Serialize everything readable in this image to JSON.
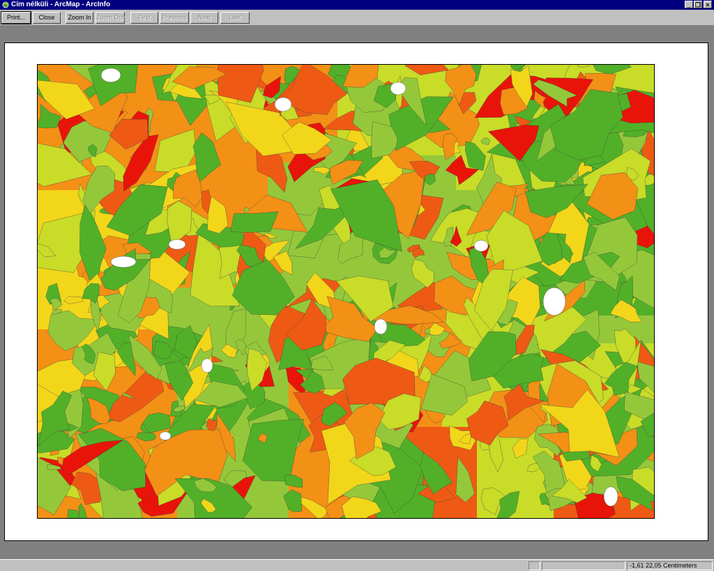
{
  "window": {
    "title": "Cím nélküli - ArcMap - ArcInfo",
    "icon": "arcmap-globe-icon",
    "controls": {
      "minimize": "_",
      "restore": "❐",
      "close": "×"
    }
  },
  "toolbar": {
    "print_label": "Print...",
    "close_label": "Close",
    "zoom_in_label": "Zoom In",
    "zoom_out_label": "Zoom Out",
    "first_label": "First",
    "previous_label": "Previous",
    "next_label": "Next",
    "last_label": "Last"
  },
  "map": {
    "palette": {
      "red": "#e8140a",
      "orange_red": "#ee5a14",
      "orange": "#f39016",
      "yellow": "#f2d61a",
      "yellow_green": "#c8dc28",
      "light_green": "#94c83a",
      "green": "#52b028",
      "line": "#3a3a3a"
    }
  },
  "status": {
    "coordinates": "-1,61  22,05 Centimeters"
  }
}
